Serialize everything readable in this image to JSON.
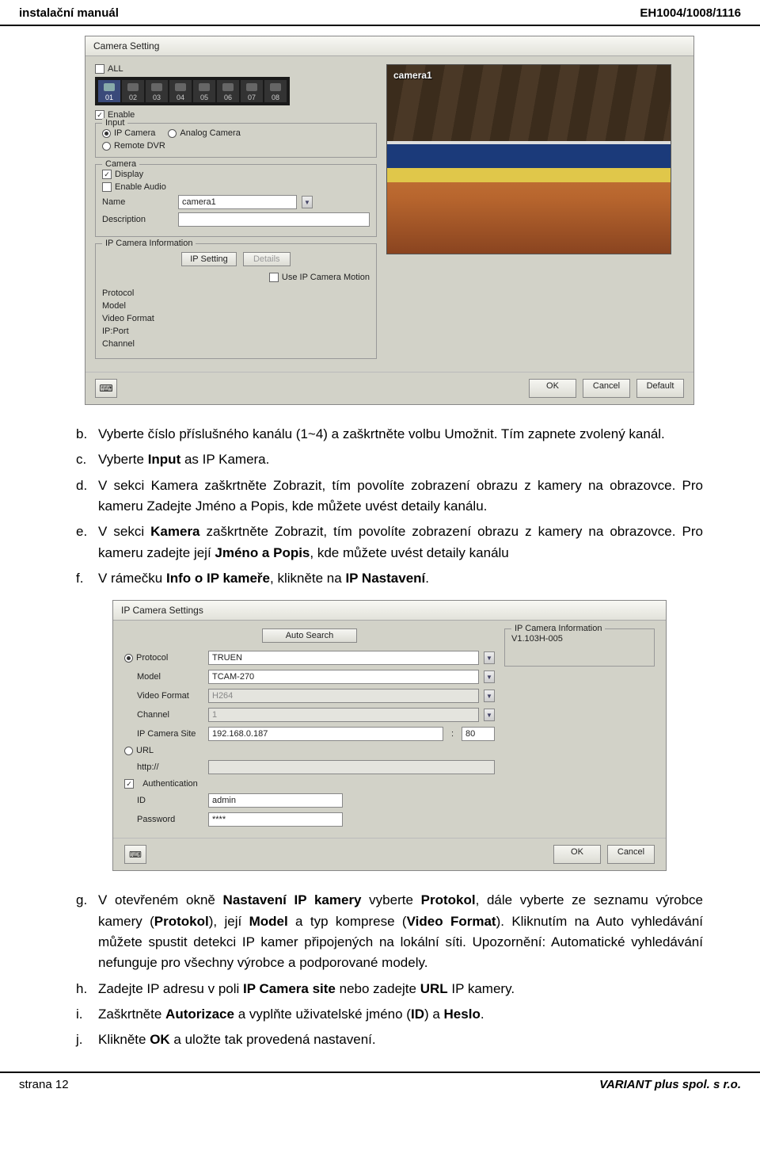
{
  "header": {
    "left": "instalační manuál",
    "right": "EH1004/1008/1116"
  },
  "dialog1": {
    "title": "Camera Setting",
    "all_label": "ALL",
    "cams": [
      "01",
      "02",
      "03",
      "04",
      "05",
      "06",
      "07",
      "08"
    ],
    "enable_label": "Enable",
    "input": {
      "legend": "Input",
      "ipcam": "IP Camera",
      "analog": "Analog Camera",
      "remote": "Remote DVR"
    },
    "camera": {
      "legend": "Camera",
      "display": "Display",
      "enable_audio": "Enable Audio",
      "name_label": "Name",
      "name_value": "camera1",
      "desc_label": "Description"
    },
    "ipinfo": {
      "legend": "IP Camera Information",
      "ipsetting_btn": "IP Setting",
      "details_btn": "Details",
      "motion_label": "Use IP Camera Motion",
      "protocol": "Protocol",
      "model": "Model",
      "video_format": "Video Format",
      "ipport": "IP:Port",
      "channel": "Channel"
    },
    "preview_label": "camera1",
    "footer": {
      "ok": "OK",
      "cancel": "Cancel",
      "default": "Default"
    }
  },
  "instr1": {
    "b": {
      "marker": "b.",
      "text": "Vyberte číslo příslušného kanálu (1~4) a zaškrtněte volbu Umožnit. Tím zapnete zvolený kanál."
    },
    "c": {
      "marker": "c.",
      "prefix": "Vyberte ",
      "bold": "Input",
      "suffix": " as IP Kamera."
    },
    "d": {
      "marker": "d.",
      "p1": "V sekci Kamera zaškrtněte Zobrazit, tím povolíte zobrazení obrazu z kamery na obrazovce. Pro kameru Zadejte Jméno a Popis, kde můžete uvést detaily kanálu."
    },
    "e": {
      "marker": "e.",
      "p1": "V sekci ",
      "b1": "Kamera",
      "p2": " zaškrtněte Zobrazit, tím povolíte zobrazení obrazu z kamery na obrazovce. Pro kameru zadejte její ",
      "b2": "Jméno a Popis",
      "p3": ", kde můžete uvést detaily kanálu"
    },
    "f": {
      "marker": "f.",
      "p1": "V rámečku ",
      "b1": "Info o IP kameře",
      "p2": ", klikněte na ",
      "b2": "IP Nastavení",
      "p3": "."
    }
  },
  "dialog2": {
    "title": "IP Camera Settings",
    "autosearch": "Auto Search",
    "info_legend": "IP Camera Information",
    "info_version": "V1.103H-005",
    "protocol_label": "Protocol",
    "protocol_value": "TRUEN",
    "model_label": "Model",
    "model_value": "TCAM-270",
    "vf_label": "Video Format",
    "vf_value": "H264",
    "channel_label": "Channel",
    "channel_value": "1",
    "site_label": "IP Camera Site",
    "site_value": "192.168.0.187",
    "port_value": "80",
    "url_label": "URL",
    "url_prefix": "http://",
    "auth_label": "Authentication",
    "id_label": "ID",
    "id_value": "admin",
    "pw_label": "Password",
    "pw_value": "****",
    "ok": "OK",
    "cancel": "Cancel"
  },
  "instr2": {
    "g": {
      "marker": "g.",
      "p1": "V otevřeném okně ",
      "b1": "Nastavení IP kamery",
      "p2": " vyberte ",
      "b2": "Protokol",
      "p3": ", dále vyberte ze seznamu výrobce kamery (",
      "b3": "Protokol",
      "p4": "), její ",
      "b4": "Model",
      "p5": " a typ komprese (",
      "b5": "Video Format",
      "p6": "). Kliknutím na Auto vyhledávání můžete spustit detekci IP kamer připojených na lokální síti. Upozornění: Automatické vyhledávání nefunguje pro všechny výrobce a podporované modely."
    },
    "h": {
      "marker": "h.",
      "p1": "Zadejte IP adresu v poli ",
      "b1": "IP Camera site",
      "p2": " nebo zadejte ",
      "b2": "URL",
      "p3": " IP kamery."
    },
    "i": {
      "marker": "i.",
      "p1": "Zaškrtněte ",
      "b1": "Autorizace",
      "p2": " a vyplňte uživatelské jméno (",
      "b2": "ID",
      "p3": ") a ",
      "b3": "Heslo",
      "p4": "."
    },
    "j": {
      "marker": "j.",
      "p1": "Klikněte ",
      "b1": "OK",
      "p2": " a uložte tak provedená nastavení."
    }
  },
  "footer": {
    "left": "strana 12",
    "right": "VARIANT plus spol. s r.o."
  }
}
